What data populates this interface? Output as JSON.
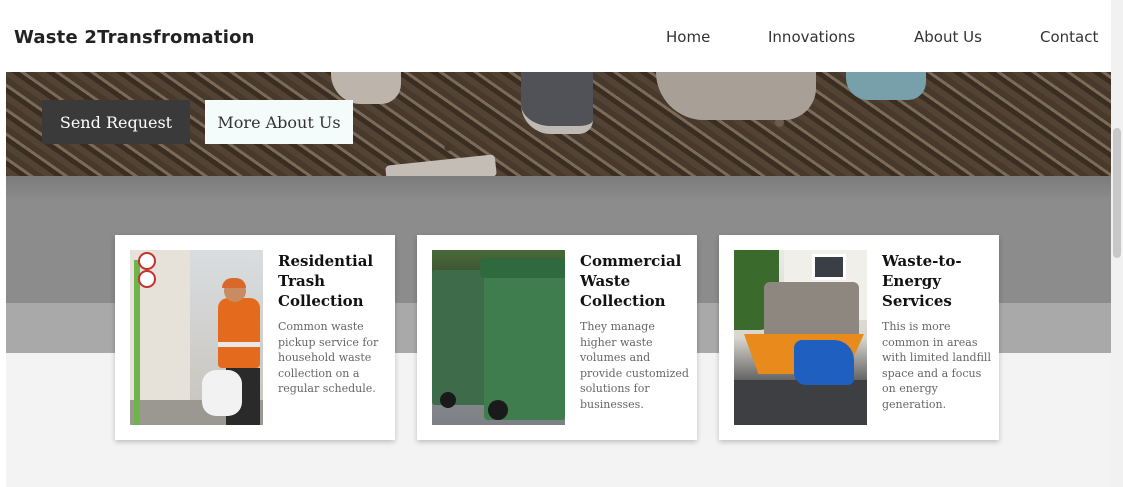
{
  "header": {
    "brand": "Waste 2Transfromation",
    "nav": [
      "Home",
      "Innovations",
      "About Us",
      "Contact"
    ]
  },
  "hero": {
    "send_request": "Send Request",
    "more_about": "More About Us"
  },
  "services": [
    {
      "title": "Residential Trash Collection",
      "description": "Common waste pickup service for household waste collection on a regular schedule."
    },
    {
      "title": "Commercial Waste Collection",
      "description": "They manage higher waste volumes and provide customized solutions for businesses."
    },
    {
      "title": "Waste-to-Energy Services",
      "description": "This is more common in areas with limited landfill space and a focus on energy generation."
    }
  ],
  "colors": {
    "primary_button": "#3a3a3a",
    "secondary_button": "#f4fbfb",
    "band_dark": "#8c8c8c",
    "band_light": "#f3f3f3"
  }
}
